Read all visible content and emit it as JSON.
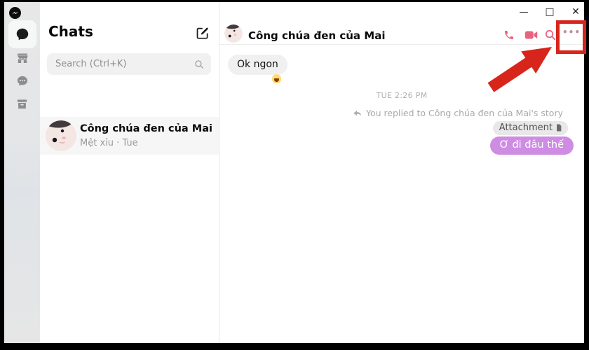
{
  "window_controls": {
    "minimize": "—",
    "maximize": "□",
    "close": "✕"
  },
  "sidebar": {
    "items": [
      {
        "id": "chats",
        "icon": "chat-bubble-icon",
        "active": true
      },
      {
        "id": "marketplace",
        "icon": "storefront-icon",
        "active": false
      },
      {
        "id": "message-requests",
        "icon": "chat-dots-icon",
        "active": false
      },
      {
        "id": "archive",
        "icon": "archive-box-icon",
        "active": false
      }
    ]
  },
  "chats_panel": {
    "title": "Chats",
    "search_placeholder": "Search (Ctrl+K)",
    "conversations": [
      {
        "name": "Công chúa đen của Mai",
        "preview": "Mệt xỉu · Tue",
        "selected": true
      }
    ]
  },
  "chat": {
    "header": {
      "title": "Công chúa đen của Mai",
      "more_label": "•••"
    },
    "timeline": {
      "incoming_message": "Ok ngon",
      "incoming_reaction": "😆",
      "timestamp": "TUE 2:26 PM",
      "reply_note": "You replied to Công chúa đen của Mai's story",
      "attachment_label": "Attachment",
      "outgoing_message": "Ơ đi đâu thế"
    }
  },
  "annotation": {
    "target": "more-options-button",
    "color": "#d8251b"
  },
  "colors": {
    "accent_pink": "#e8637f",
    "outgoing_bubble_purple": "#ce8ce3",
    "incoming_bubble_gray": "#f1f0f0",
    "highlight_red": "#d8251b"
  }
}
